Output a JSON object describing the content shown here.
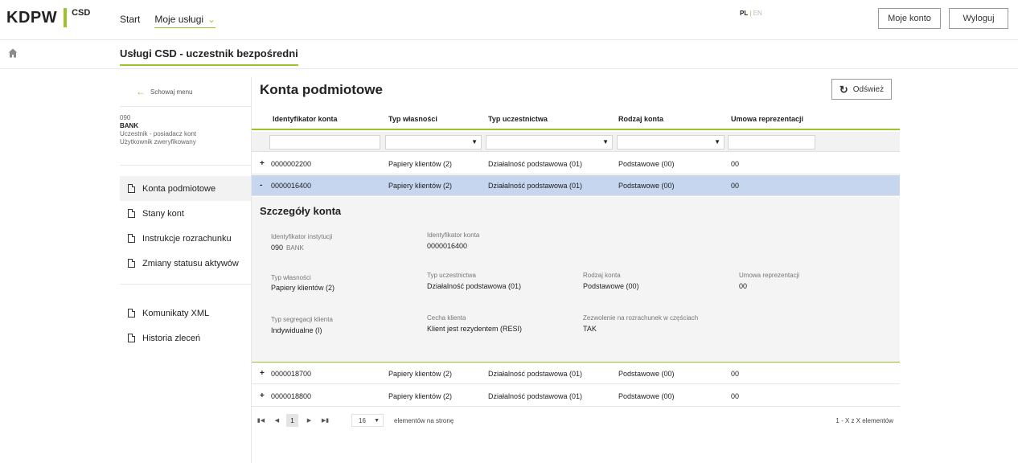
{
  "header": {
    "logo_main": "KDPW",
    "logo_sub": "CSD",
    "nav": [
      {
        "label": "Start"
      },
      {
        "label": "Moje usługi"
      }
    ],
    "lang_pl": "PL",
    "lang_sep": "|",
    "lang_en": "EN",
    "account_label": "Moje konto",
    "logout_label": "Wyloguj"
  },
  "subheader": {
    "title": "Usługi CSD - uczestnik bezpośredni"
  },
  "sidebar": {
    "hide_menu": "Schowaj menu",
    "user": {
      "code": "090",
      "name": "BANK",
      "role": "Uczestnik - posiadacz kont",
      "status": "Użytkownik zweryfikowany"
    },
    "items": [
      {
        "label": "Konta podmiotowe"
      },
      {
        "label": "Stany kont"
      },
      {
        "label": "Instrukcje rozrachunku"
      },
      {
        "label": "Zmiany statusu aktywów"
      },
      {
        "label": "Komunikaty XML"
      },
      {
        "label": "Historia zleceń"
      }
    ]
  },
  "main": {
    "title": "Konta podmiotowe",
    "refresh_label": "Odśwież",
    "columns": [
      "Identyfikator konta",
      "Typ własności",
      "Typ uczestnictwa",
      "Rodzaj konta",
      "Umowa reprezentacji"
    ],
    "rows": [
      {
        "toggle": "+",
        "id": "0000002200",
        "ownership": "Papiery klientów (2)",
        "participation": "Działalność podstawowa (01)",
        "kind": "Podstawowe (00)",
        "agreement": "00"
      },
      {
        "toggle": "-",
        "id": "0000016400",
        "ownership": "Papiery klientów (2)",
        "participation": "Działalność podstawowa (01)",
        "kind": "Podstawowe (00)",
        "agreement": "00"
      },
      {
        "toggle": "+",
        "id": "0000018700",
        "ownership": "Papiery klientów (2)",
        "participation": "Działalność podstawowa (01)",
        "kind": "Podstawowe (00)",
        "agreement": "00"
      },
      {
        "toggle": "+",
        "id": "0000018800",
        "ownership": "Papiery klientów (2)",
        "participation": "Działalność podstawowa (01)",
        "kind": "Podstawowe (00)",
        "agreement": "00"
      }
    ],
    "details": {
      "title": "Szczegóły konta",
      "institution_label": "Identyfikator instytucji",
      "institution_code": "090",
      "institution_name": "BANK",
      "account_id_label": "Identyfikator konta",
      "account_id": "0000016400",
      "ownership_label": "Typ własności",
      "ownership": "Papiery klientów (2)",
      "participation_label": "Typ uczestnictwa",
      "participation": "Działalność podstawowa (01)",
      "kind_label": "Rodzaj konta",
      "kind": "Podstawowe (00)",
      "agreement_label": "Umowa reprezentacji",
      "agreement": "00",
      "segregation_label": "Typ segregacji klienta",
      "segregation": "Indywidualne (I)",
      "feature_label": "Cecha klienta",
      "feature": "Klient jest rezydentem (RESI)",
      "partial_label": "Zezwolenie na rozrachunek w częściach",
      "partial": "TAK"
    },
    "pager": {
      "current_page": "1",
      "page_size": "16",
      "per_page_label": "elementów na stronę",
      "range": "1 - X z X elementów"
    }
  },
  "colors": {
    "accent": "#9cc42a",
    "selected_row": "#c5d6ee"
  }
}
